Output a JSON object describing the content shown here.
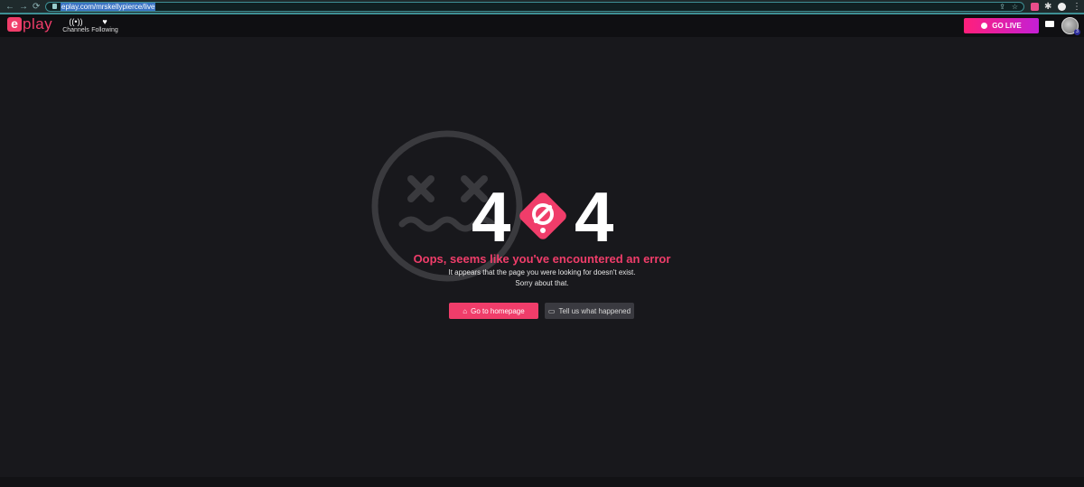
{
  "browser": {
    "url": "eplay.com/mrskellypierce/live",
    "back_icon": "arrow-left-icon",
    "forward_icon": "arrow-right-icon",
    "reload_icon": "reload-icon"
  },
  "header": {
    "logo_letter": "e",
    "logo_word": "play",
    "nav": [
      {
        "label": "Channels",
        "icon": "broadcast-icon",
        "glyph": "((•))"
      },
      {
        "label": "Following",
        "icon": "heart-icon",
        "glyph": "♥"
      }
    ],
    "go_live_label": "GO LIVE",
    "notification_count": "3"
  },
  "error": {
    "code_left": "4",
    "code_right": "4",
    "title": "Oops, seems like you've encountered an error",
    "line1": "It appears that the page you were looking for doesn't exist.",
    "line2": "Sorry about that.",
    "home_button": "Go to homepage",
    "tell_button": "Tell us what happened"
  },
  "colors": {
    "accent": "#f03d6a",
    "background": "#18181c",
    "header": "#0f0f12"
  }
}
